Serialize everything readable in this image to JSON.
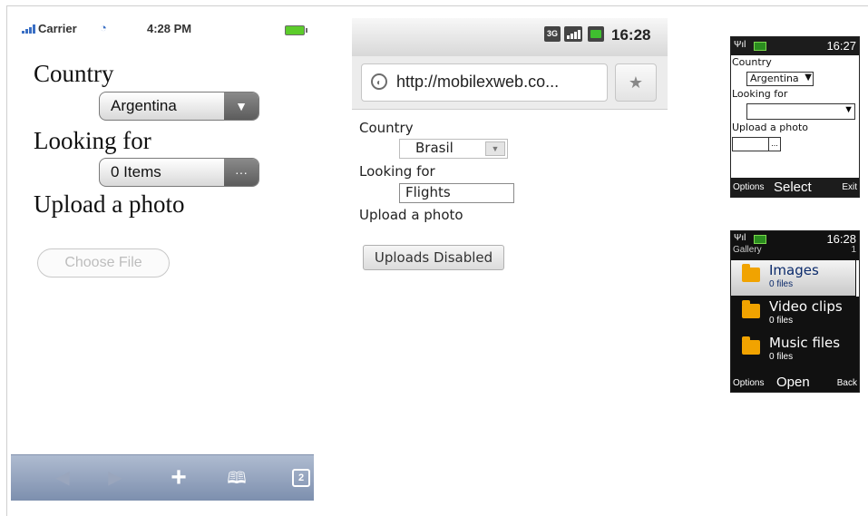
{
  "iphone": {
    "carrier": "Carrier",
    "time": "4:28 PM",
    "country_label": "Country",
    "country_value": "Argentina",
    "looking_label": "Looking for",
    "looking_value": "0 Items",
    "looking_button": "···",
    "upload_label": "Upload a photo",
    "choose_file": "Choose File",
    "tabs_count": "2"
  },
  "android": {
    "net_label": "3G",
    "time": "16:28",
    "url": "http://mobilexweb.co...",
    "country_label": "Country",
    "country_value": "Brasil",
    "looking_label": "Looking for",
    "looking_value": "Flights",
    "upload_label": "Upload a photo",
    "upload_button": "Uploads Disabled"
  },
  "nokia_form": {
    "time": "16:27",
    "country_label": "Country",
    "country_value": "Argentina",
    "looking_label": "Looking for",
    "upload_label": "Upload a photo",
    "file_button": "...",
    "soft_left": "Options",
    "soft_center": "Select",
    "soft_right": "Exit"
  },
  "nokia_gallery": {
    "time": "16:28",
    "title": "Gallery",
    "count": "1",
    "items": [
      {
        "name": "Images",
        "files": "0 files"
      },
      {
        "name": "Video clips",
        "files": "0 files"
      },
      {
        "name": "Music files",
        "files": "0 files"
      }
    ],
    "soft_left": "Options",
    "soft_center": "Open",
    "soft_right": "Back"
  },
  "colors": {
    "iphone_toolbar": "#8293b2",
    "android_accent": "#3fbf2f",
    "nokia_folder": "#f1a300"
  }
}
